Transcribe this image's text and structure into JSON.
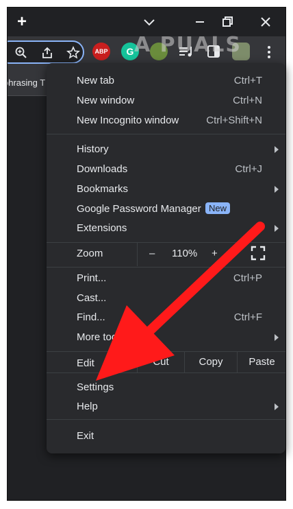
{
  "titlebar": {
    "new_tab_symbol": "+"
  },
  "toolbar": {
    "abp_label": "ABP",
    "grammarly_label": "G",
    "watermark": "A  PUALS"
  },
  "bookmarks": {
    "item": "phrasing T"
  },
  "menu": {
    "new_tab": {
      "label": "New tab",
      "shortcut": "Ctrl+T"
    },
    "new_window": {
      "label": "New window",
      "shortcut": "Ctrl+N"
    },
    "new_incognito": {
      "label": "New Incognito window",
      "shortcut": "Ctrl+Shift+N"
    },
    "history": {
      "label": "History"
    },
    "downloads": {
      "label": "Downloads",
      "shortcut": "Ctrl+J"
    },
    "bookmarks": {
      "label": "Bookmarks"
    },
    "password_manager": {
      "label": "Google Password Manager",
      "badge": "New"
    },
    "extensions": {
      "label": "Extensions"
    },
    "zoom": {
      "label": "Zoom",
      "minus": "–",
      "value": "110%",
      "plus": "+"
    },
    "print": {
      "label": "Print...",
      "shortcut": "Ctrl+P"
    },
    "cast": {
      "label": "Cast..."
    },
    "find": {
      "label": "Find...",
      "shortcut": "Ctrl+F"
    },
    "more_tools": {
      "label": "More tools"
    },
    "edit": {
      "label": "Edit",
      "cut": "Cut",
      "copy": "Copy",
      "paste": "Paste"
    },
    "settings": {
      "label": "Settings"
    },
    "help": {
      "label": "Help"
    },
    "exit": {
      "label": "Exit"
    }
  },
  "colors": {
    "accent": "#8ab4f8",
    "arrow": "#ff1a1a",
    "menu_bg": "#292a2d"
  }
}
